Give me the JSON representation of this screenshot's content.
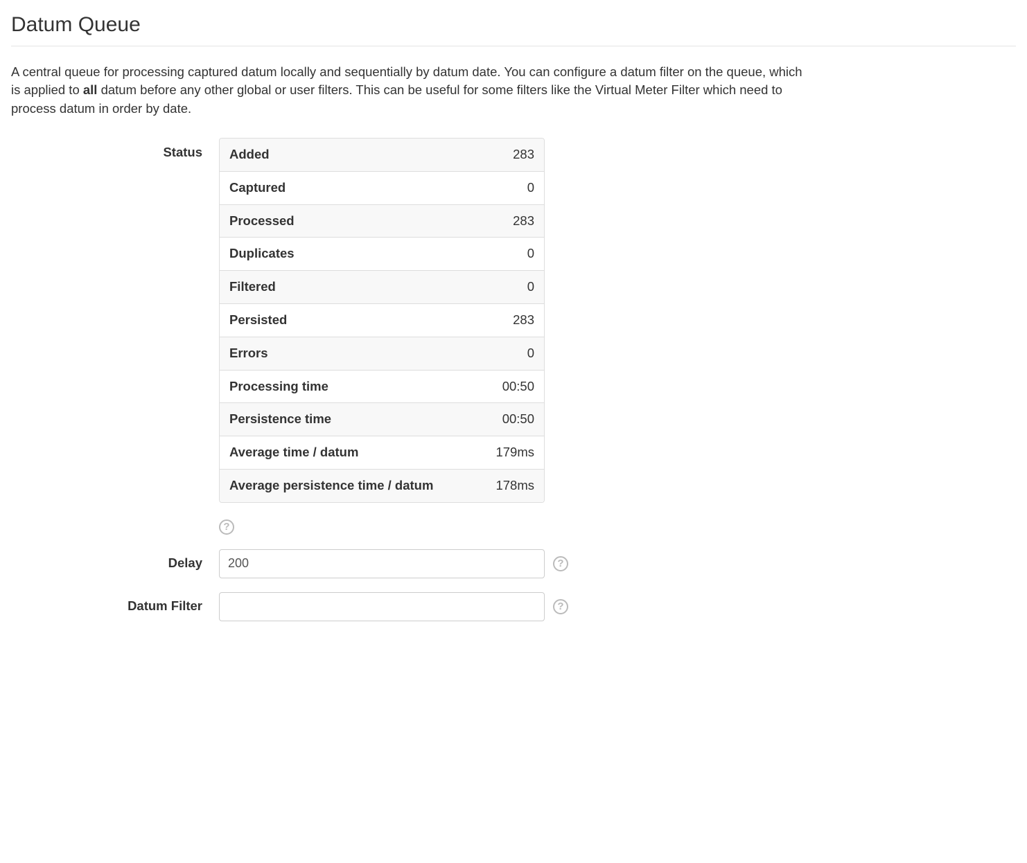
{
  "page": {
    "title": "Datum Queue",
    "description_pre": "A central queue for processing captured datum locally and sequentially by datum date. You can configure a datum filter on the queue, which is applied to ",
    "description_bold": "all",
    "description_post": " datum before any other global or user filters. This can be useful for some filters like the Virtual Meter Filter which need to process datum in order by date."
  },
  "labels": {
    "status": "Status",
    "delay": "Delay",
    "datum_filter": "Datum Filter"
  },
  "status": {
    "rows": [
      {
        "key": "Added",
        "value": "283"
      },
      {
        "key": "Captured",
        "value": "0"
      },
      {
        "key": "Processed",
        "value": "283"
      },
      {
        "key": "Duplicates",
        "value": "0"
      },
      {
        "key": "Filtered",
        "value": "0"
      },
      {
        "key": "Persisted",
        "value": "283"
      },
      {
        "key": "Errors",
        "value": "0"
      },
      {
        "key": "Processing time",
        "value": "00:50"
      },
      {
        "key": "Persistence time",
        "value": "00:50"
      },
      {
        "key": "Average time / datum",
        "value": "179ms"
      },
      {
        "key": "Average persistence time / datum",
        "value": "178ms"
      }
    ]
  },
  "fields": {
    "delay_value": "200",
    "datum_filter_value": ""
  },
  "icons": {
    "help_glyph": "?"
  }
}
